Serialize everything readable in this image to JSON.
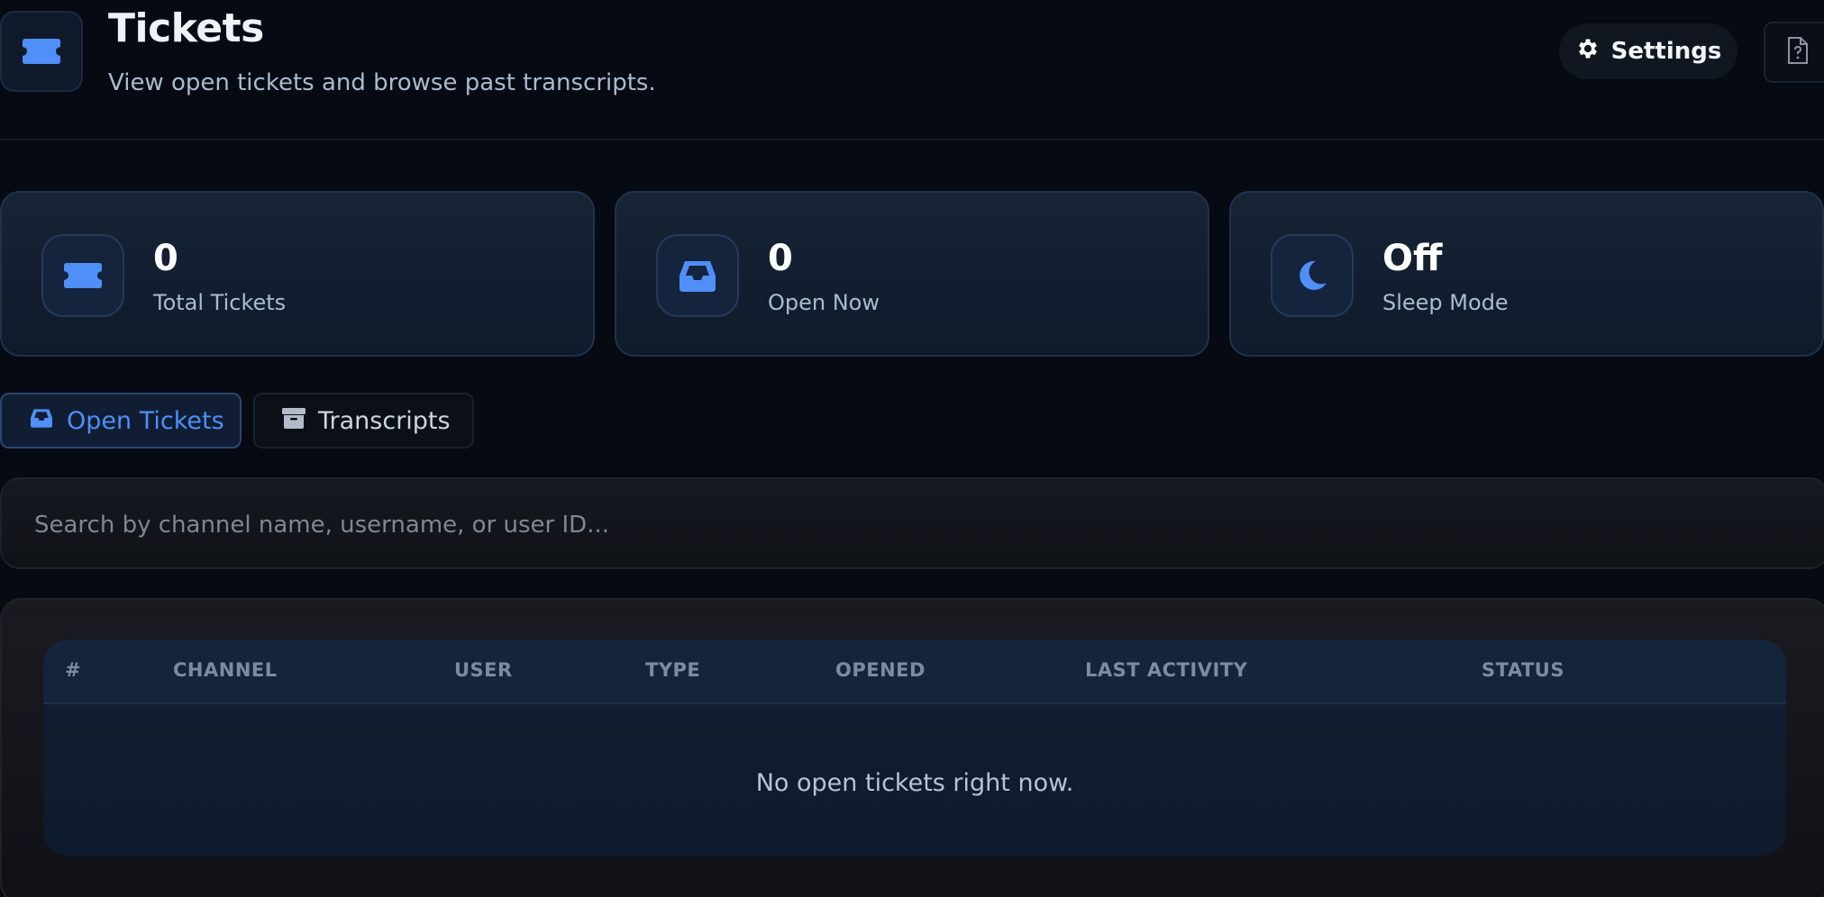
{
  "header": {
    "title": "Tickets",
    "subtitle": "View open tickets and browse past transcripts.",
    "settings_label": "Settings",
    "icon": "ticket-icon",
    "help_icon": "help-file-icon"
  },
  "stats": [
    {
      "value": "0",
      "label": "Total Tickets",
      "icon": "ticket-icon"
    },
    {
      "value": "0",
      "label": "Open Now",
      "icon": "inbox-icon"
    },
    {
      "value": "Off",
      "label": "Sleep Mode",
      "icon": "moon-icon"
    }
  ],
  "tabs": {
    "open": {
      "label": "Open Tickets",
      "icon": "inbox-icon",
      "active": true
    },
    "transcripts": {
      "label": "Transcripts",
      "icon": "archive-icon",
      "active": false
    }
  },
  "search": {
    "placeholder": "Search by channel name, username, or user ID...",
    "value": ""
  },
  "table": {
    "columns": [
      "#",
      "CHANNEL",
      "USER",
      "TYPE",
      "OPENED",
      "LAST ACTIVITY",
      "STATUS"
    ],
    "empty_message": "No open tickets right now.",
    "rows": []
  },
  "colors": {
    "accent": "#4f8ff7",
    "background": "#060a12",
    "card": "#142033"
  }
}
